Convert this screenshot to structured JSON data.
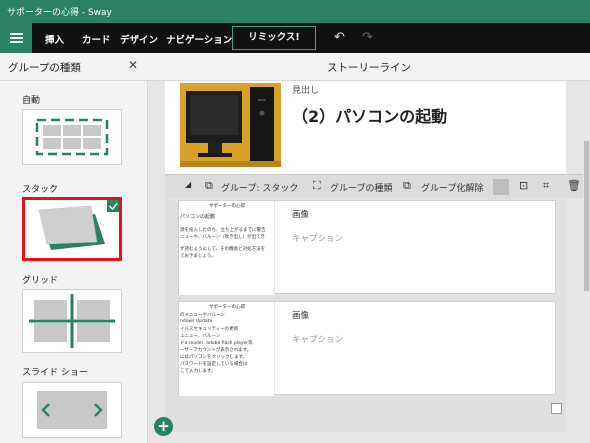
{
  "window": {
    "title": "サポーターの心得 - Sway"
  },
  "toolbar": {
    "menu_items": [
      "挿入",
      "カード",
      "デザイン",
      "ナビゲーション"
    ],
    "remix_label": "リミックス!"
  },
  "left_panel": {
    "title": "グループの種類",
    "sections": [
      {
        "label": "自動"
      },
      {
        "label": "スタック",
        "selected": true
      },
      {
        "label": "グリッド"
      },
      {
        "label": "スライド ショー"
      }
    ]
  },
  "main": {
    "title": "ストーリーライン",
    "heading_card": {
      "kicker": "見出し",
      "text": "（2）パソコンの起動"
    },
    "group_toolbar": {
      "stack_label": "グループ: スタック",
      "type_label": "グループの種類",
      "ungroup_label": "グループ化解除"
    },
    "image_cards": [
      {
        "label": "画像",
        "caption_placeholder": "キャプション",
        "doc_title": "サポーターの心得",
        "doc_lines": [
          "パソコンの起動",
          "",
          "源を投入したのち、立ち上がるまでに警告",
          "ニューや、バルーン（吹き出し）が出てき",
          "",
          "ず読むようにして、その機会と対処方法を",
          "ておきましょう。"
        ]
      },
      {
        "label": "画像",
        "caption_placeholder": "キャプション",
        "doc_title": "サポーターの心得",
        "doc_lines": [
          "のメニューやバルーン",
          "ndows Update",
          "イルスセキュリティーの更新",
          "ュニュー、バルーン",
          "ドe reader, adobe flash player等",
          "ーザーアカウントが表示されます。",
          "にはパソコンをクリックします。",
          "パスワードを設定している場合は",
          "こで入力します。"
        ]
      }
    ]
  },
  "colors": {
    "accent": "#2a8263",
    "toolbar_bg": "#111111",
    "highlight": "#e0141e"
  }
}
